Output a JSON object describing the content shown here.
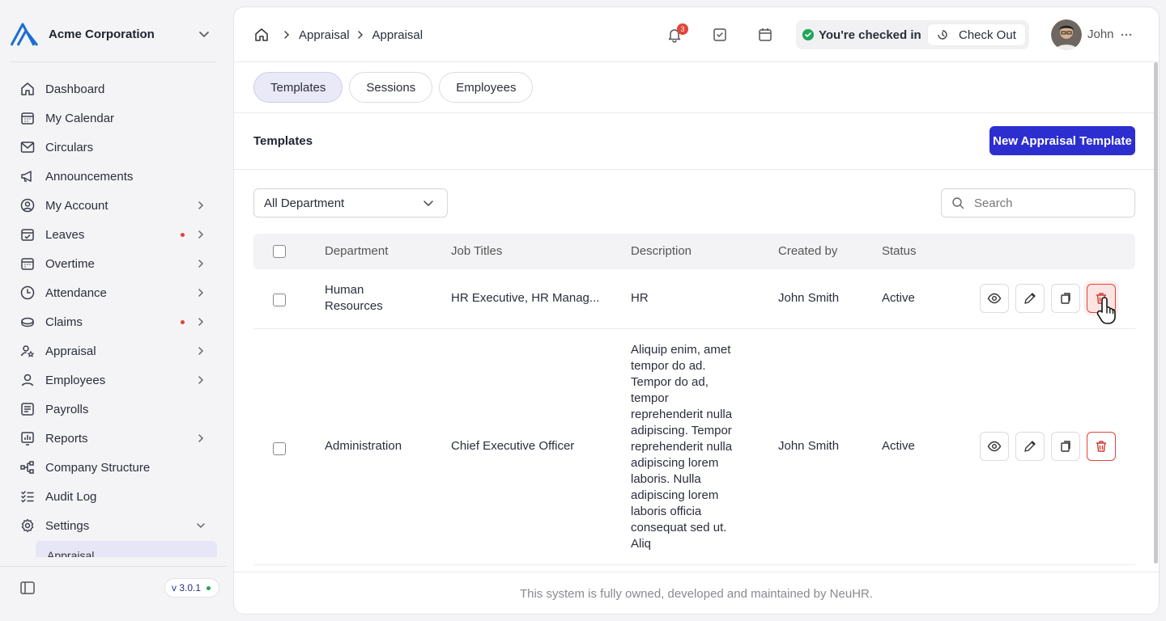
{
  "org": {
    "name": "Acme Corporation"
  },
  "sidebar": {
    "items": [
      {
        "label": "Dashboard",
        "icon": "home-icon"
      },
      {
        "label": "My Calendar",
        "icon": "calendar-icon"
      },
      {
        "label": "Circulars",
        "icon": "mail-icon"
      },
      {
        "label": "Announcements",
        "icon": "megaphone-icon"
      },
      {
        "label": "My Account",
        "icon": "user-circle-icon",
        "expandable": true
      },
      {
        "label": "Leaves",
        "icon": "calendar-check-icon",
        "expandable": true,
        "dot": true
      },
      {
        "label": "Overtime",
        "icon": "calendar-clock-icon",
        "expandable": true
      },
      {
        "label": "Attendance",
        "icon": "clock-icon",
        "expandable": true
      },
      {
        "label": "Claims",
        "icon": "coins-icon",
        "expandable": true,
        "dot": true
      },
      {
        "label": "Appraisal",
        "icon": "user-star-icon",
        "expandable": true
      },
      {
        "label": "Employees",
        "icon": "user-icon",
        "expandable": true
      },
      {
        "label": "Payrolls",
        "icon": "receipt-icon"
      },
      {
        "label": "Reports",
        "icon": "chart-icon",
        "expandable": true
      },
      {
        "label": "Company Structure",
        "icon": "hierarchy-icon"
      },
      {
        "label": "Audit Log",
        "icon": "checklist-icon"
      },
      {
        "label": "Settings",
        "icon": "gear-icon",
        "expanded": true
      }
    ],
    "active_sub_label": "Appraisal",
    "version": "v 3.0.1"
  },
  "header": {
    "breadcrumbs": [
      "Appraisal",
      "Appraisal"
    ],
    "notification_count": "3",
    "checkin_status": "You're checked in",
    "checkout_label": "Check Out",
    "user_name": "John"
  },
  "tabs": [
    {
      "label": "Templates",
      "active": true
    },
    {
      "label": "Sessions",
      "active": false
    },
    {
      "label": "Employees",
      "active": false
    }
  ],
  "section": {
    "title": "Templates",
    "new_button_label": "New Appraisal Template"
  },
  "filters": {
    "department_value": "All Department",
    "search_placeholder": "Search"
  },
  "table": {
    "columns": [
      "Department",
      "Job Titles",
      "Description",
      "Created by",
      "Status"
    ],
    "rows": [
      {
        "department": "Human Resources",
        "job_titles": "HR Executive, HR Manag...",
        "description": "HR",
        "created_by": "John Smith",
        "status": "Active"
      },
      {
        "department": "Administration",
        "job_titles": "Chief Executive Officer",
        "description": "Aliquip enim, amet tempor do ad. Tempor do ad, tempor reprehenderit nulla adipiscing. Tempor reprehenderit nulla adipiscing lorem laboris. Nulla adipiscing lorem laboris officia consequat sed ut. Aliq",
        "created_by": "John Smith",
        "status": "Active"
      }
    ]
  },
  "footer": {
    "text": "This system is fully owned, developed and maintained by NeuHR."
  },
  "colors": {
    "primary": "#2c2ed0",
    "danger": "#e0443a",
    "success": "#22a55a"
  }
}
